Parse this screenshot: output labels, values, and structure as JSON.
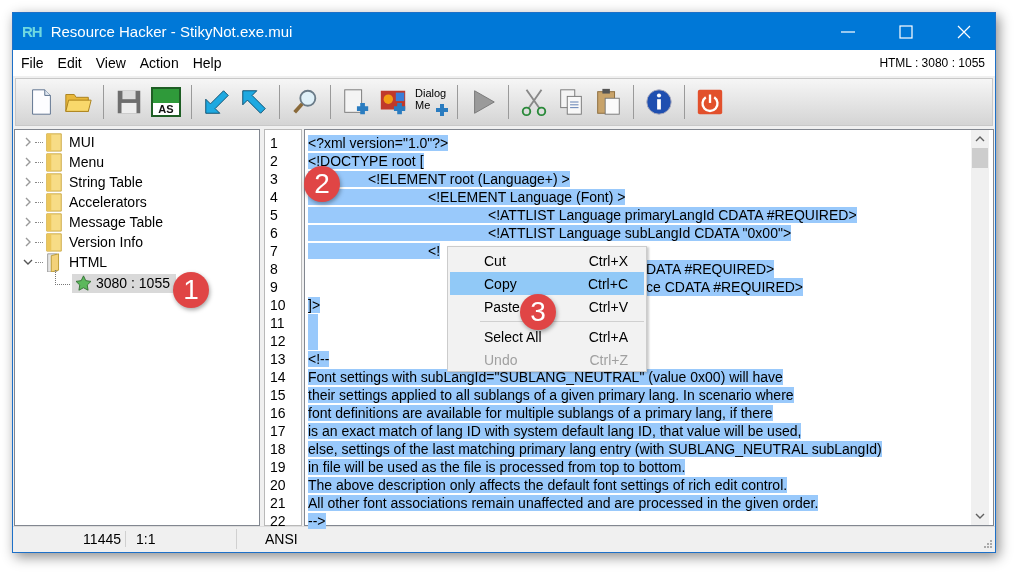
{
  "window": {
    "logo_text": "RH",
    "title": "Resource Hacker - StikyNot.exe.mui"
  },
  "menu_bar": {
    "items": [
      "File",
      "Edit",
      "View",
      "Action",
      "Help"
    ],
    "resource_label": "HTML : 3080 : 1055"
  },
  "toolbar": [
    {
      "kind": "new"
    },
    {
      "kind": "open"
    },
    {
      "kind": "separator"
    },
    {
      "kind": "save"
    },
    {
      "kind": "save-as",
      "label": "AS"
    },
    {
      "kind": "separator"
    },
    {
      "kind": "arrow-in"
    },
    {
      "kind": "arrow-out"
    },
    {
      "kind": "separator"
    },
    {
      "kind": "find"
    },
    {
      "kind": "separator"
    },
    {
      "kind": "add-blank"
    },
    {
      "kind": "add-image"
    },
    {
      "kind": "add-dialog",
      "label": "Dialog",
      "label_2": "Me"
    },
    {
      "kind": "separator"
    },
    {
      "kind": "play"
    },
    {
      "kind": "separator"
    },
    {
      "kind": "cut"
    },
    {
      "kind": "copy"
    },
    {
      "kind": "paste"
    },
    {
      "kind": "separator"
    },
    {
      "kind": "info"
    },
    {
      "kind": "separator"
    },
    {
      "kind": "power"
    }
  ],
  "tree": {
    "items": [
      {
        "label": "MUI",
        "expanded": false
      },
      {
        "label": "Menu",
        "expanded": false
      },
      {
        "label": "String Table",
        "expanded": false
      },
      {
        "label": "Accelerators",
        "expanded": false
      },
      {
        "label": "Message Table",
        "expanded": false
      },
      {
        "label": "Version Info",
        "expanded": false
      },
      {
        "label": "HTML",
        "expanded": true,
        "children": [
          {
            "label": "3080 : 1055",
            "selected": true
          }
        ]
      }
    ]
  },
  "editor": {
    "all_selected": true,
    "lines": [
      {
        "number": "1",
        "text": "<?xml version=\"1.0\"?>"
      },
      {
        "number": "2",
        "text": "<!DOCTYPE root ["
      },
      {
        "number": "3",
        "text": "\t<!ELEMENT root (Language+) >"
      },
      {
        "number": "4",
        "text": "\t\t<!ELEMENT Language (Font) >"
      },
      {
        "number": "5",
        "text": "\t\t\t<!ATTLIST Language primaryLangId CDATA #REQUIRED>"
      },
      {
        "number": "6",
        "text": "\t\t\t<!ATTLIST Language subLangId CDATA \"0x00\">"
      },
      {
        "number": "7",
        "text": "\t\t<!"
      },
      {
        "number": "8",
        "text_right": "DATA #REQUIRED>"
      },
      {
        "number": "9",
        "text_right": "ce CDATA #REQUIRED>"
      },
      {
        "number": "10",
        "text": "]>"
      },
      {
        "number": "11"
      },
      {
        "number": "12"
      },
      {
        "number": "13",
        "text": "<!--"
      },
      {
        "number": "14",
        "text": "Font settings with subLangId=\"SUBLANG_NEUTRAL\" (value 0x00) will have"
      },
      {
        "number": "15",
        "text": "their settings applied to all sublangs of a given primary lang. In scenario where"
      },
      {
        "number": "16",
        "text": "font definitions are available for multiple sublangs of a primary lang, if there"
      },
      {
        "number": "17",
        "text": "is an exact match of lang ID with system default lang ID, that value will be used,"
      },
      {
        "number": "18",
        "text": "else, settings of the last matching primary lang entry (with SUBLANG_NEUTRAL subLangId)"
      },
      {
        "number": "19",
        "text": "in file will be used as the file is processed from top to bottom."
      },
      {
        "number": "20",
        "text": "The above description only affects the default font settings of rich edit control."
      },
      {
        "number": "21",
        "text": "All other font associations remain unaffected and are processed in the given order."
      },
      {
        "number": "22",
        "text": "-->"
      }
    ]
  },
  "context_menu": {
    "items": [
      {
        "kind": "item",
        "label": "Cut",
        "shortcut": "Ctrl+X",
        "selected": false,
        "disabled": false
      },
      {
        "kind": "item",
        "label": "Copy",
        "shortcut": "Ctrl+C",
        "selected": true,
        "disabled": false
      },
      {
        "kind": "item",
        "label": "Paste",
        "shortcut": "Ctrl+V",
        "selected": false,
        "disabled": false
      },
      {
        "kind": "separator"
      },
      {
        "kind": "item",
        "label": "Select All",
        "shortcut": "Ctrl+A",
        "selected": false,
        "disabled": false
      },
      {
        "kind": "item",
        "label": "Undo",
        "shortcut": "Ctrl+Z",
        "selected": false,
        "disabled": true
      }
    ]
  },
  "status_bar": {
    "size": "11445",
    "position": "1:1",
    "encoding": "ANSI"
  },
  "callouts": [
    "1",
    "2",
    "3"
  ]
}
